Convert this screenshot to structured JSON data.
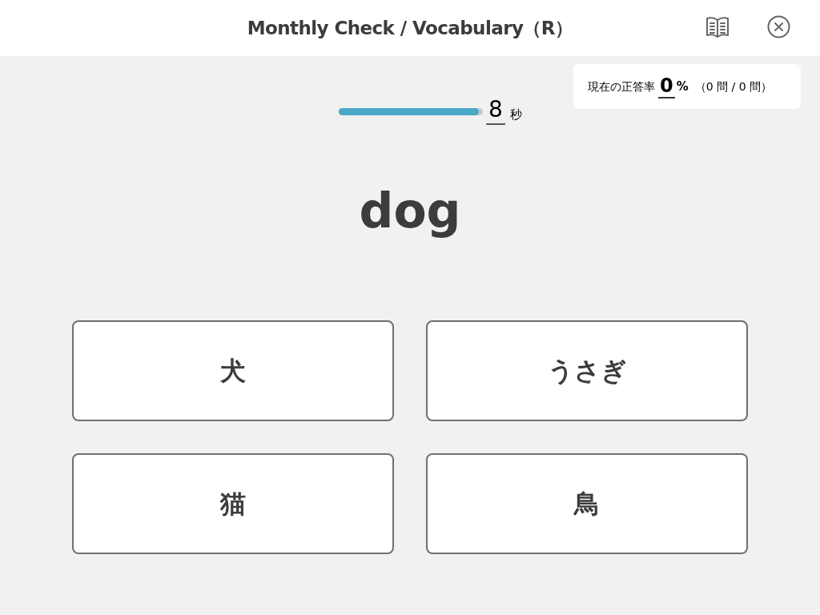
{
  "header": {
    "title": "Monthly Check / Vocabulary（R）"
  },
  "timer": {
    "level": 0.97,
    "seconds": "8",
    "unit": "秒"
  },
  "score": {
    "label": "現在の正答率",
    "value": "0",
    "unit": "%",
    "count": "（0 問 / 0 問）"
  },
  "question": {
    "word": "dog"
  },
  "answers": [
    {
      "label": "犬"
    },
    {
      "label": "うさぎ"
    },
    {
      "label": "猫"
    },
    {
      "label": "鳥"
    }
  ]
}
